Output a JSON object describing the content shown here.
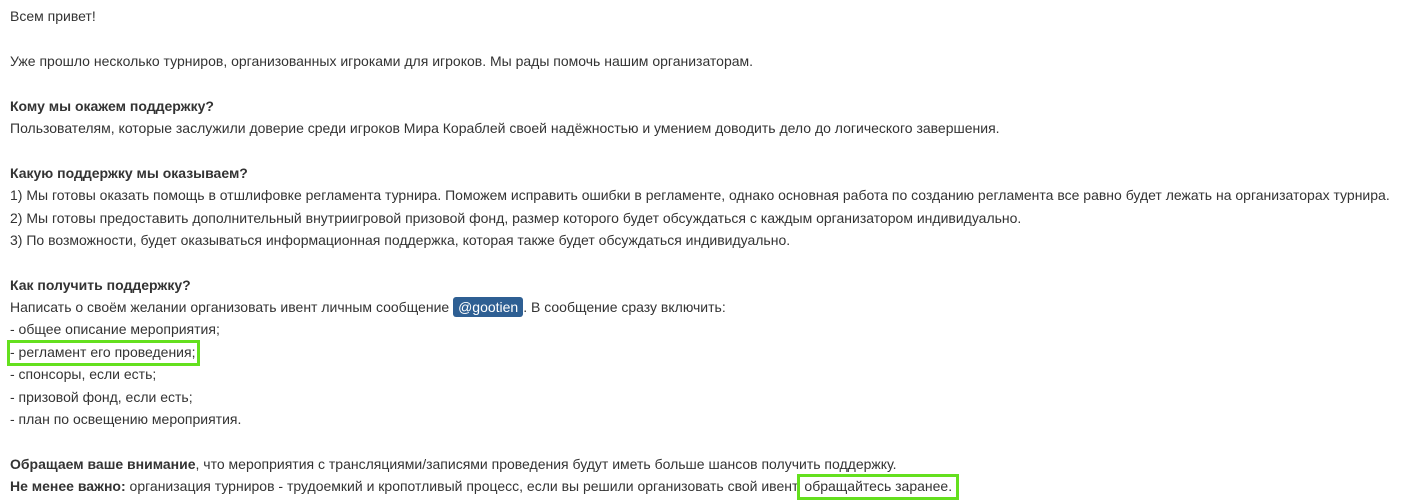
{
  "post": {
    "greeting": "Всем привет!",
    "intro": "Уже прошло несколько турниров, организованных игроками для игроков. Мы рады помочь нашим организаторам.",
    "who": {
      "heading": "Кому мы окажем поддержку?",
      "text": "Пользователям, которые заслужили доверие среди игроков Мира Кораблей своей надёжностью и умением доводить дело до логического завершения."
    },
    "what": {
      "heading": "Какую поддержку мы оказываем?",
      "items": [
        "1) Мы готовы оказать помощь в отшлифовке регламента турнира. Поможем исправить ошибки в регламенте, однако основная работа по созданию регламента все равно будет лежать на организаторах турнира.",
        "2) Мы готовы предоставить дополнительный внутриигровой призовой фонд, размер которого будет обсуждаться с каждым организатором индивидуально.",
        "3) По возможности, будет оказываться информационная поддержка, которая также будет обсуждаться индивидуально."
      ]
    },
    "how": {
      "heading": "Как получить поддержку?",
      "text_before": "Написать о своём желании организовать ивент личным сообщение ",
      "mention": "@gootien",
      "text_after": ". В сообщение сразу включить:",
      "items": [
        "- общее описание мероприятия;",
        "- регламент его проведения;",
        "- спонсоры, если есть;",
        "- призовой фонд, если есть;",
        "- план по освещению мероприятия."
      ]
    },
    "notes": {
      "attention_bold": "Обращаем ваше внимание",
      "attention_text": ", что мероприятия с трансляциями/записями проведения будут иметь больше шансов получить поддержку.",
      "important_bold": "Не менее важно:",
      "important_text": " организация турниров - трудоемкий и кропотливый процесс, если вы решили организовать свой ивент",
      "important_end": "обращайтесь заранее."
    }
  },
  "colors": {
    "text": "#333333",
    "mention_bg": "#2e5f93",
    "highlight": "#64e01e"
  }
}
